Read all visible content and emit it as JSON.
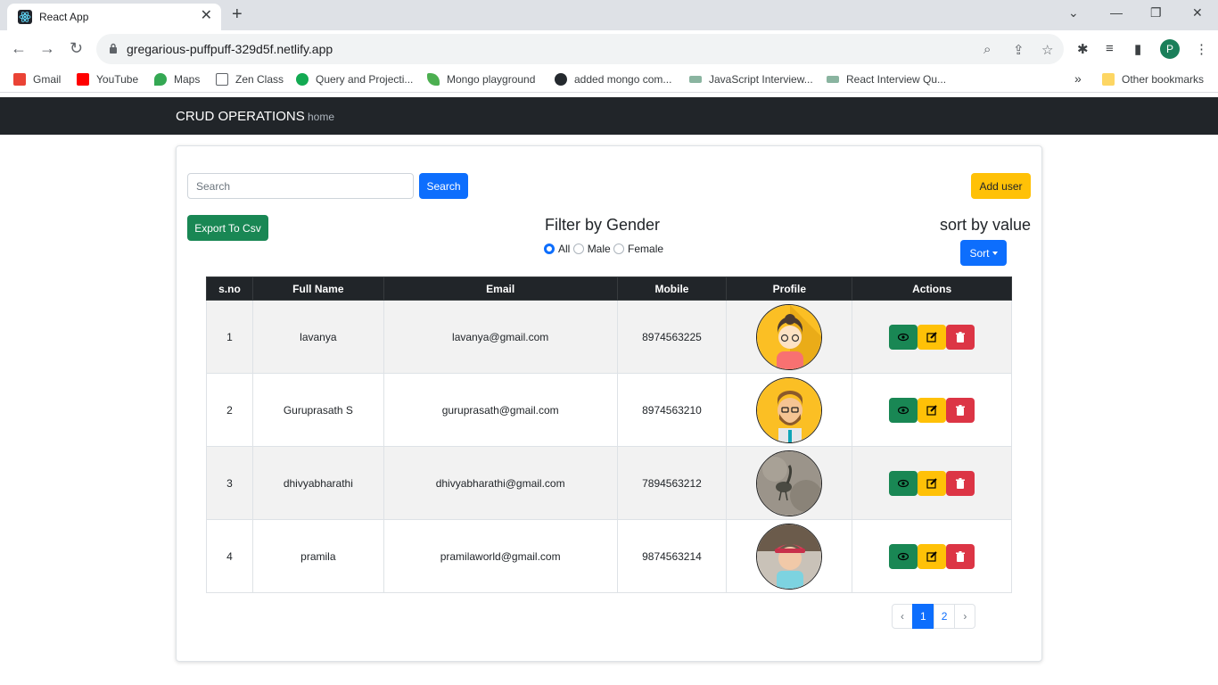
{
  "browser": {
    "tab_title": "React App",
    "tab_close": "✕",
    "new_tab": "+",
    "url": "gregarious-puffpuff-329d5f.netlify.app",
    "profile_initial": "P",
    "window_controls": [
      "⌄",
      "—",
      "❐",
      "✕"
    ],
    "bookmarks": [
      {
        "label": "Gmail",
        "color": "#ea4335"
      },
      {
        "label": "YouTube",
        "color": "#ff0000"
      },
      {
        "label": "Maps",
        "color": "#34a853"
      },
      {
        "label": "Zen Class",
        "color": "#5f6368"
      },
      {
        "label": "Query and Projecti...",
        "color": "#13aa52"
      },
      {
        "label": "Mongo playground",
        "color": "#4caf50"
      },
      {
        "label": "added mongo com...",
        "color": "#24292e"
      },
      {
        "label": "JavaScript Interview...",
        "color": "#8ab4a0"
      },
      {
        "label": "React Interview Qu...",
        "color": "#8ab4a0"
      }
    ],
    "bookmarks_overflow": "»",
    "other_bookmarks": "Other bookmarks"
  },
  "navbar": {
    "brand": "CRUD OPERATIONS",
    "home_link": "home"
  },
  "controls": {
    "search_placeholder": "Search",
    "search_value": "",
    "search_button": "Search",
    "add_user_button": "Add user",
    "export_button": "Export To Csv",
    "filter_title": "Filter by Gender",
    "gender_options": [
      "All",
      "Male",
      "Female"
    ],
    "gender_selected": "All",
    "sort_title": "sort by value",
    "sort_button": "Sort"
  },
  "table": {
    "headers": [
      "s.no",
      "Full Name",
      "Email",
      "Mobile",
      "Profile",
      "Actions"
    ],
    "rows": [
      {
        "sno": "1",
        "name": "lavanya",
        "email": "lavanya@gmail.com",
        "mobile": "8974563225",
        "profile": "female-cartoon"
      },
      {
        "sno": "2",
        "name": "Guruprasath S",
        "email": "guruprasath@gmail.com",
        "mobile": "8974563210",
        "profile": "male-cartoon"
      },
      {
        "sno": "3",
        "name": "dhivyabharathi",
        "email": "dhivyabharathi@gmail.com",
        "mobile": "7894563212",
        "profile": "bird-photo"
      },
      {
        "sno": "4",
        "name": "pramila",
        "email": "pramilaworld@gmail.com",
        "mobile": "9874563214",
        "profile": "child-photo"
      }
    ]
  },
  "pagination": {
    "prev": "‹",
    "pages": [
      "1",
      "2"
    ],
    "active": "1",
    "next": "›"
  },
  "colors": {
    "primary": "#0d6efd",
    "success": "#198754",
    "warning": "#ffc107",
    "danger": "#dc3545",
    "dark": "#212529"
  }
}
